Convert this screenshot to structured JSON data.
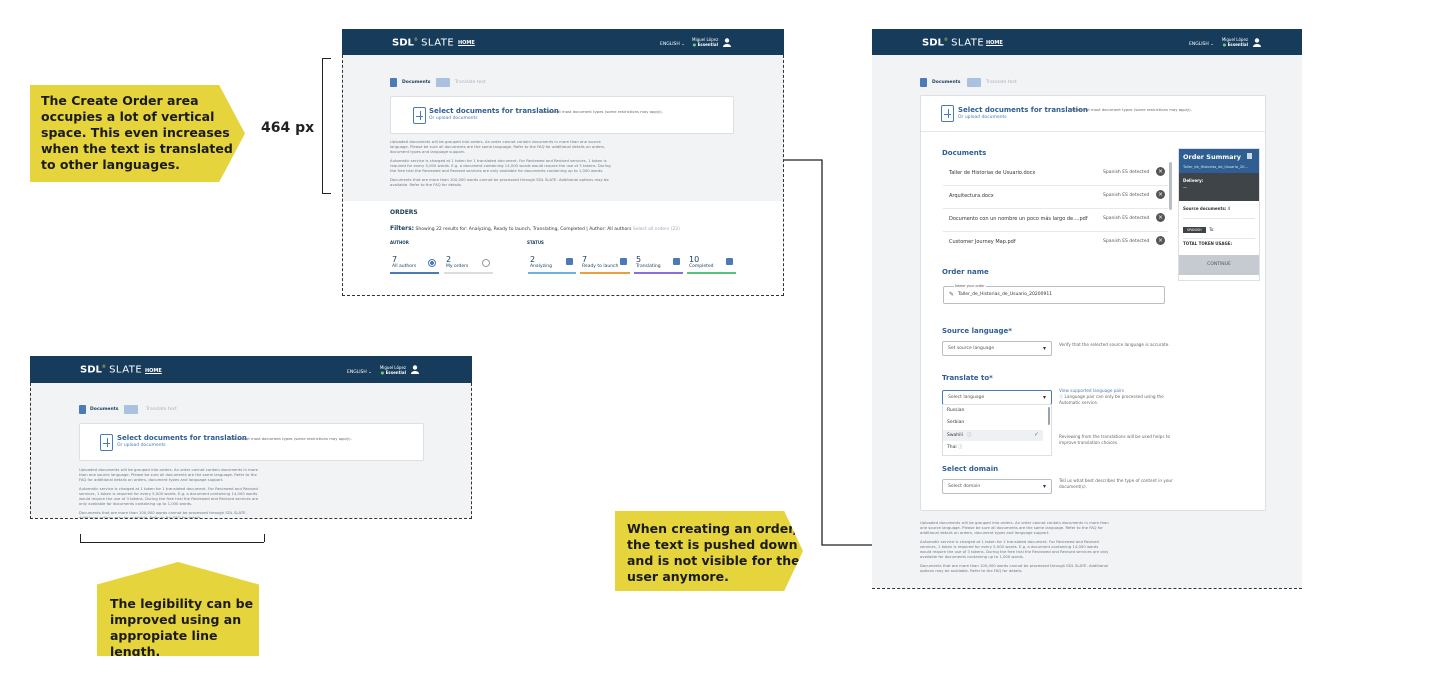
{
  "callouts": {
    "top_left": [
      "The Create Order area",
      "occupies a lot of vertical",
      "space. This even increases",
      "when the text is translated",
      "to other languages."
    ],
    "measure": "464 px",
    "bottom_left": [
      "The legibility can be",
      "improved using an",
      "appropiate line length."
    ],
    "bottom_right": [
      "When creating an order,",
      "the text is pushed down",
      "and is not visible for the",
      "user anymore."
    ]
  },
  "app": {
    "logo_brand": "SDL",
    "logo_product": "SLATE",
    "nav_home": "HOME",
    "language": "ENGLISH",
    "user_name": "Miguel López",
    "user_plan": "Essential",
    "tab_documents": "Documents",
    "tab_translate": "Translate text",
    "select_title": "Select documents for translation",
    "select_upload": "Or upload documents",
    "select_note": "We accept most document types (some restrictions may apply).",
    "info_paragraphs": [
      "Uploaded documents will be grouped into orders. An order cannot contain documents in more than one source language. Please be sure all documents are the same language. Refer to the FAQ for additional details on orders, document types and language support.",
      "Automatic service is charged at 1 token for 1 translated document. For Reviewed and Revised services, 1 token is required for every 5,000 words. E.g. a document containing 14,000 words would require the use of 3 tokens. During the free trial the Reviewed and Revised services are only available for documents containing up to 1,000 words.",
      "Documents that are more than 100,000 words cannot be processed through SDL SLATE. Additional options may be available. Refer to the FAQ for details."
    ]
  },
  "orders": {
    "title": "ORDERS",
    "filters_label": "Filters:",
    "filters_text": "Showing 22 results for: Analyzing, Ready to launch, Translating, Completed | Author: All authors",
    "reset_label": "Select all orders (22)",
    "author_label": "AUTHOR",
    "status_label": "STATUS",
    "author_items": [
      {
        "count": "7",
        "label": "All authors"
      },
      {
        "count": "2",
        "label": "My orders"
      }
    ],
    "status_items": [
      {
        "count": "2",
        "label": "Analyzing"
      },
      {
        "count": "7",
        "label": "Ready to launch"
      },
      {
        "count": "5",
        "label": "Translating"
      },
      {
        "count": "10",
        "label": "Completed"
      }
    ]
  },
  "order_form": {
    "documents_title": "Documents",
    "documents": [
      {
        "name": "Taller de Historias de Usuario.docx",
        "detected": "Spanish ES detected"
      },
      {
        "name": "Arquitectura.docx",
        "detected": "Spanish ES detected"
      },
      {
        "name": "Documento con un nombre un poco más largo de....pdf",
        "detected": "Spanish ES detected"
      },
      {
        "name": "Customer Journey Map.pdf",
        "detected": "Spanish ES detected"
      }
    ],
    "order_name_title": "Order name",
    "order_name_caption": "Name your order",
    "order_name_value": "Taller_de_Historias_de_Usuario_20200911",
    "source_title": "Source language*",
    "source_placeholder": "Set source language",
    "source_help": "Verify that the selected source language is accurate.",
    "translate_title": "Translate to*",
    "translate_placeholder": "Select language",
    "translate_link": "View supported language pairs",
    "translate_help": "Language pair can only be processed using the Automatic service.",
    "language_options": [
      "Russian",
      "Serbian",
      "Swahili",
      "Thai"
    ],
    "review_help": "Reviewing from the translations will be used helps to improve translation choices.",
    "domain_title": "Select domain",
    "domain_placeholder": "Select domain",
    "domain_help": "Tell us what best describes the type of content in your document(s).",
    "summary_title": "Order Summary",
    "summary_file": "Taller_de_Historias_de_Usuario_20...",
    "summary_delivery": "Delivery:",
    "summary_delivery_value": "—",
    "summary_source": "Source documents:",
    "summary_source_value": "4",
    "summary_tag": "SPANISH",
    "summary_to": "To:",
    "summary_tokens": "TOTAL TOKEN USAGE:",
    "summary_continue": "CONTINUE"
  }
}
